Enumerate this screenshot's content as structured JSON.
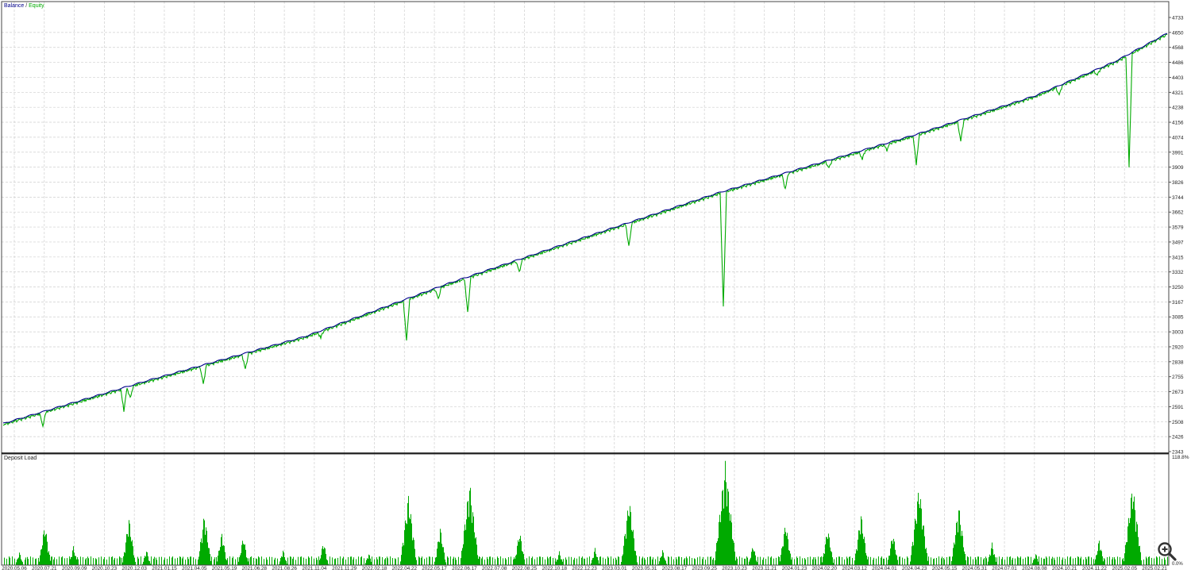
{
  "chart_data": [
    {
      "type": "line",
      "title": "Balance / Equity",
      "title_parts": {
        "balance": "Balance",
        "separator": " / ",
        "equity": "Equity"
      },
      "x_labels": [
        "2020.05.06",
        "2020.07.21",
        "2020.09.09",
        "2020.10.23",
        "2020.12.03",
        "2021.01.15",
        "2021.04.05",
        "2021.05.19",
        "2021.06.28",
        "2021.08.26",
        "2021.11.04",
        "2021.11.29",
        "2022.02.18",
        "2022.04.22",
        "2022.05.17",
        "2022.06.17",
        "2022.07.08",
        "2022.08.25",
        "2022.10.18",
        "2022.12.23",
        "2023.03.01",
        "2023.05.31",
        "2023.08.17",
        "2023.09.25",
        "2023.10.23",
        "2023.11.21",
        "2024.01.23",
        "2024.02.20",
        "2024.03.12",
        "2024.04.01",
        "2024.04.23",
        "2024.05.15",
        "2024.05.31",
        "2024.07.01",
        "2024.08.08",
        "2024.10.21",
        "2024.11.22",
        "2025.02.05",
        "2025.02.21"
      ],
      "y_ticks": [
        "4733",
        "4650",
        "4568",
        "4486",
        "4403",
        "4321",
        "4238",
        "4156",
        "4074",
        "3991",
        "3909",
        "3826",
        "3744",
        "3662",
        "3579",
        "3497",
        "3415",
        "3332",
        "3250",
        "3167",
        "3085",
        "3003",
        "2920",
        "2838",
        "2755",
        "2673",
        "2591",
        "2508",
        "2426",
        "2343"
      ],
      "ylim": [
        2343,
        4733
      ],
      "grid": true,
      "series": [
        {
          "name": "Balance",
          "color": "#00008b",
          "points": [
            [
              0,
              2500
            ],
            [
              180,
              2725
            ],
            [
              380,
              2960
            ],
            [
              560,
              3240
            ],
            [
              700,
              3440
            ],
            [
              900,
              3720
            ],
            [
              1150,
              4030
            ],
            [
              1300,
              4235
            ],
            [
              1400,
              4415
            ],
            [
              1466,
              4565
            ]
          ]
        },
        {
          "name": "Equity",
          "color": "#00aa00",
          "drawdowns": [
            {
              "x": 50,
              "depth": 70
            },
            {
              "x": 152,
              "depth": 115
            },
            {
              "x": 160,
              "depth": 60
            },
            {
              "x": 252,
              "depth": 95
            },
            {
              "x": 305,
              "depth": 80
            },
            {
              "x": 400,
              "depth": 30
            },
            {
              "x": 508,
              "depth": 215
            },
            {
              "x": 548,
              "depth": 55
            },
            {
              "x": 585,
              "depth": 185
            },
            {
              "x": 650,
              "depth": 60
            },
            {
              "x": 788,
              "depth": 120
            },
            {
              "x": 907,
              "depth": 605
            },
            {
              "x": 985,
              "depth": 80
            },
            {
              "x": 1040,
              "depth": 35
            },
            {
              "x": 1082,
              "depth": 40
            },
            {
              "x": 1113,
              "depth": 30
            },
            {
              "x": 1150,
              "depth": 150
            },
            {
              "x": 1206,
              "depth": 105
            },
            {
              "x": 1330,
              "depth": 45
            },
            {
              "x": 1378,
              "depth": 25
            },
            {
              "x": 1418,
              "depth": 590
            }
          ]
        }
      ]
    },
    {
      "type": "bar",
      "title": "Deposit Load",
      "y_ticks": [
        "118.8%",
        "0.0%"
      ],
      "ylim": [
        0,
        118.8
      ],
      "color": "#00aa00",
      "peaks": [
        {
          "x": 20,
          "value": 15
        },
        {
          "x": 52,
          "value": 48
        },
        {
          "x": 88,
          "value": 22
        },
        {
          "x": 158,
          "value": 55
        },
        {
          "x": 180,
          "value": 18
        },
        {
          "x": 253,
          "value": 60
        },
        {
          "x": 275,
          "value": 38
        },
        {
          "x": 302,
          "value": 34
        },
        {
          "x": 352,
          "value": 18
        },
        {
          "x": 403,
          "value": 28
        },
        {
          "x": 460,
          "value": 14
        },
        {
          "x": 510,
          "value": 82
        },
        {
          "x": 550,
          "value": 44
        },
        {
          "x": 587,
          "value": 97
        },
        {
          "x": 650,
          "value": 40
        },
        {
          "x": 700,
          "value": 16
        },
        {
          "x": 745,
          "value": 20
        },
        {
          "x": 788,
          "value": 78
        },
        {
          "x": 830,
          "value": 18
        },
        {
          "x": 909,
          "value": 120
        },
        {
          "x": 944,
          "value": 24
        },
        {
          "x": 985,
          "value": 50
        },
        {
          "x": 1038,
          "value": 44
        },
        {
          "x": 1080,
          "value": 60
        },
        {
          "x": 1120,
          "value": 38
        },
        {
          "x": 1153,
          "value": 93
        },
        {
          "x": 1203,
          "value": 70
        },
        {
          "x": 1245,
          "value": 26
        },
        {
          "x": 1300,
          "value": 14
        },
        {
          "x": 1380,
          "value": 30
        },
        {
          "x": 1422,
          "value": 95
        }
      ]
    }
  ],
  "ui": {
    "zoom_icon": "zoom-in-icon"
  }
}
